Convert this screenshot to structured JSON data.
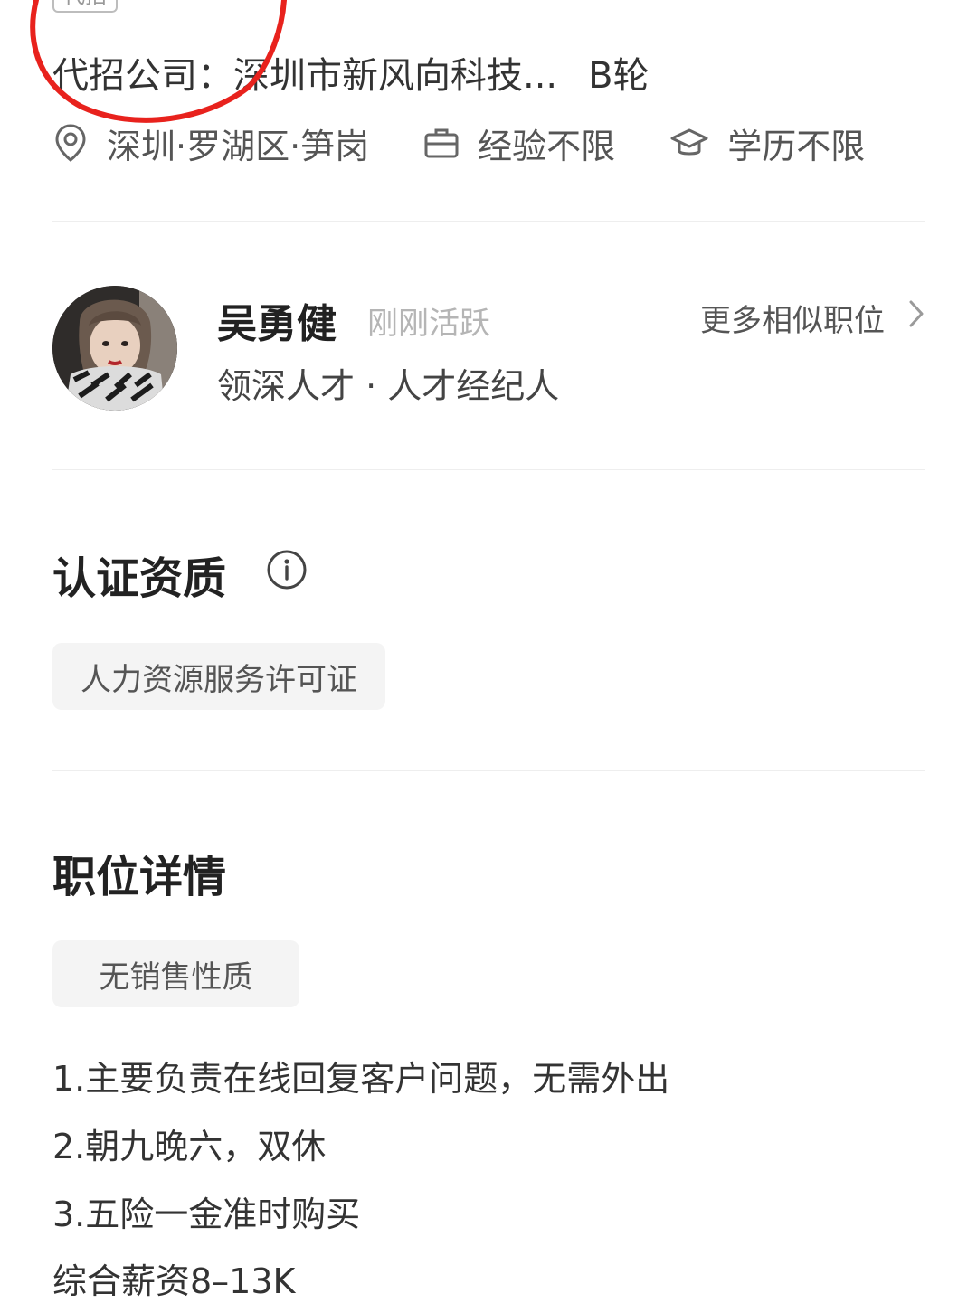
{
  "top_tag": "代招",
  "company": {
    "label": "代招公司：",
    "name": "深圳市新风向科技...",
    "funding_round": "B轮"
  },
  "meta": {
    "location": "深圳·罗湖区·笋岗",
    "experience": "经验不限",
    "education": "学历不限",
    "icons": [
      "location-pin-icon",
      "briefcase-icon",
      "graduation-cap-icon"
    ]
  },
  "recruiter": {
    "name": "吴勇健",
    "status": "刚刚活跃",
    "company_role": "领深人才 · 人才经纪人",
    "more_similar": "更多相似职位"
  },
  "certification": {
    "title": "认证资质",
    "chip": "人力资源服务许可证"
  },
  "job_detail": {
    "title": "职位详情",
    "tag": "无销售性质",
    "lines": [
      "1.主要负责在线回复客户问题，无需外出",
      "2.朝九晚六，双休",
      "3.五险一金准时购买",
      "综合薪资8–13K"
    ]
  },
  "colors": {
    "annotation_circle": "#e8221d",
    "divider": "#eeeeee",
    "chip_bg": "#f4f4f4",
    "status_gray": "#b5b5b5"
  }
}
